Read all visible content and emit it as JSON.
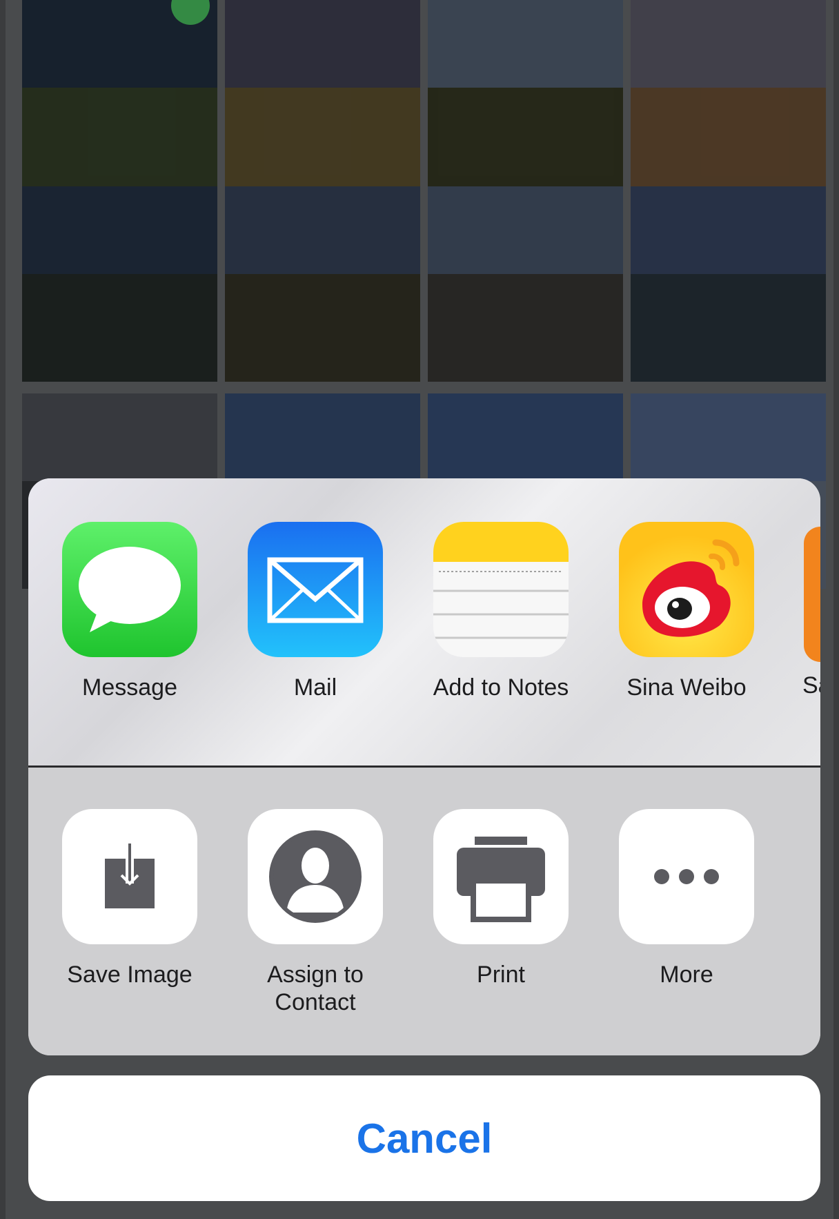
{
  "share_apps": [
    {
      "label": "Message",
      "icon": "messages-icon"
    },
    {
      "label": "Mail",
      "icon": "mail-icon"
    },
    {
      "label": "Add to Notes",
      "icon": "notes-icon"
    },
    {
      "label": "Sina Weibo",
      "icon": "weibo-icon"
    },
    {
      "label": "Sa",
      "icon": "app-icon-partial"
    }
  ],
  "actions": [
    {
      "label": "Save Image",
      "icon": "save-image-icon"
    },
    {
      "label": "Assign to Contact",
      "icon": "contact-icon"
    },
    {
      "label": "Print",
      "icon": "printer-icon"
    },
    {
      "label": "More",
      "icon": "more-icon"
    }
  ],
  "cancel_label": "Cancel",
  "colors": {
    "accent": "#1a73e8",
    "messages_green": "#34c759",
    "mail_blue": "#1e88f5",
    "notes_yellow": "#ffd60a",
    "weibo_red": "#e6162d",
    "action_icon_gray": "#5b5b60"
  }
}
